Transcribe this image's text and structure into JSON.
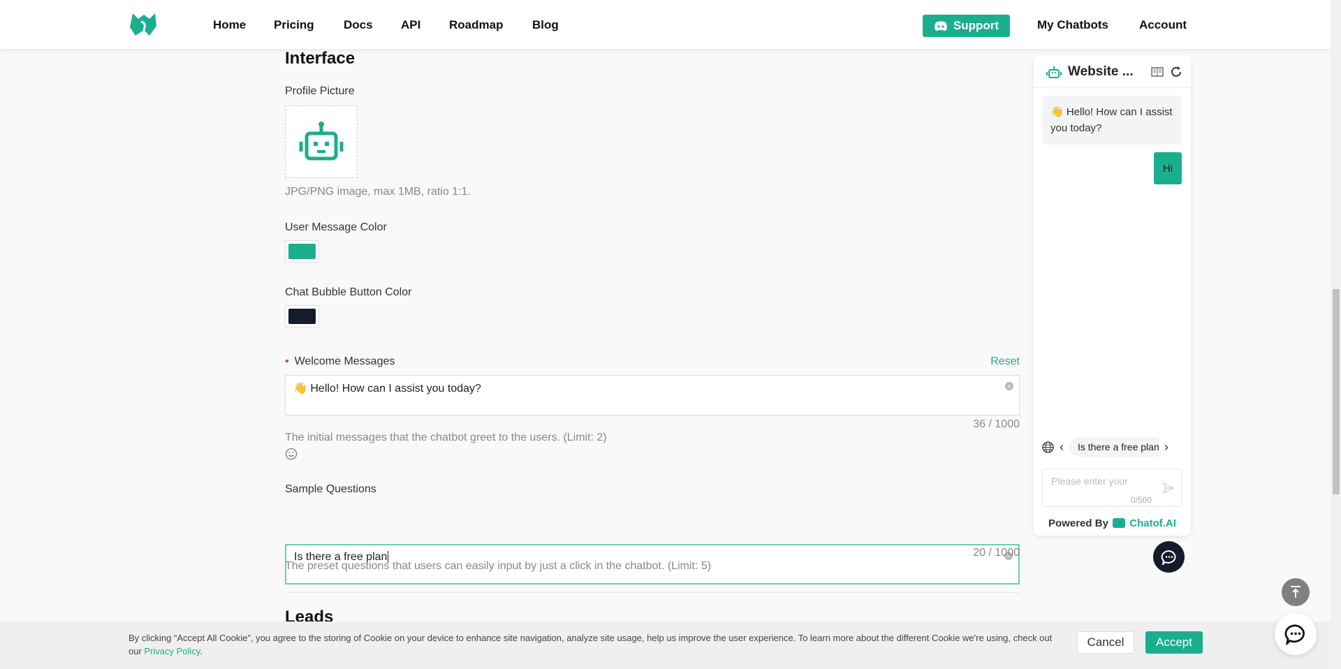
{
  "nav": {
    "items": [
      "Home",
      "Pricing",
      "Docs",
      "API",
      "Roadmap",
      "Blog"
    ],
    "support": "Support",
    "my_chatbots": "My Chatbots",
    "account": "Account"
  },
  "colors": {
    "brand": "#1aae8f",
    "user_message": "#1aae8f",
    "chat_bubble_button": "#141b2d"
  },
  "form": {
    "section_title": "Interface",
    "profile_picture_label": "Profile Picture",
    "profile_picture_help": "JPG/PNG image, max 1MB, ratio 1:1.",
    "user_message_color_label": "User Message Color",
    "chat_bubble_color_label": "Chat Bubble Button Color",
    "welcome_label": "Welcome Messages",
    "reset": "Reset",
    "welcome_value": "👋 Hello! How can I assist you today?",
    "welcome_count": "36 / 1000",
    "welcome_help": "The initial messages that the chatbot greet to the users. (Limit: 2)",
    "sample_label": "Sample Questions",
    "sample_value": "Is there a free plan",
    "sample_count": "20 / 1000",
    "sample_help": "The preset questions that users can easily input by just a click in the chatbot. (Limit: 5)",
    "next_section": "Leads"
  },
  "chat": {
    "title": "Website ...",
    "bot_message": "👋 Hello! How can I assist you today?",
    "user_message": "Hi",
    "suggestion": "Is there a free plan",
    "input_placeholder": "Please enter your question",
    "input_count": "0/500",
    "powered_by": "Powered By",
    "brand": "Chatof.AI"
  },
  "cookie": {
    "text": "By clicking “Accept All Cookie”, you agree to the storing of Cookie on your device to enhance site navigation, analyze site usage, help us improve the user experience. To learn more about the different Cookie we're using, check out our ",
    "link": "Privacy Policy",
    "end": ".",
    "cancel": "Cancel",
    "accept": "Accept"
  }
}
